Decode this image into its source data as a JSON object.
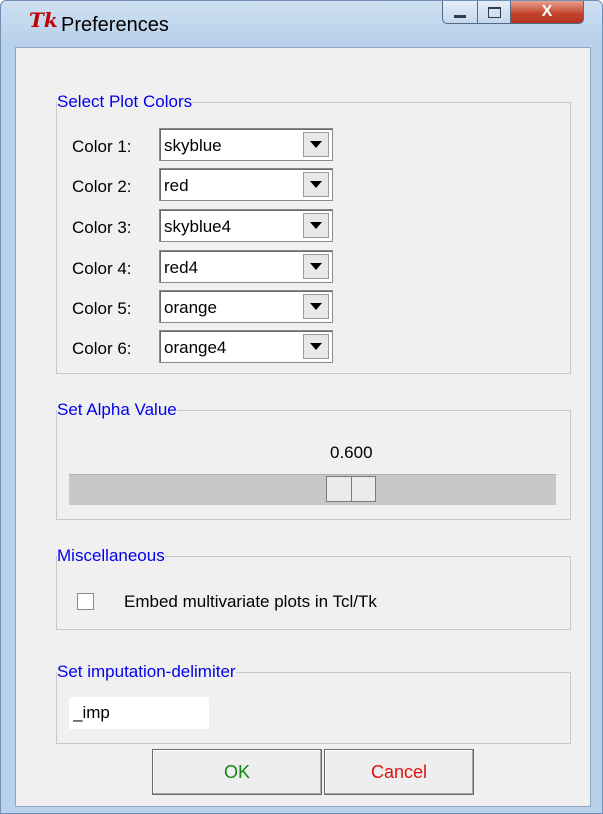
{
  "window": {
    "title": "Preferences",
    "icon": "tk-icon",
    "controls": {
      "close_label": "X"
    }
  },
  "plot_colors": {
    "legend": "Select Plot Colors",
    "rows": [
      {
        "label": "Color 1:",
        "value": "skyblue"
      },
      {
        "label": "Color 2:",
        "value": "red"
      },
      {
        "label": "Color 3:",
        "value": "skyblue4"
      },
      {
        "label": "Color 4:",
        "value": "red4"
      },
      {
        "label": "Color 5:",
        "value": "orange"
      },
      {
        "label": "Color 6:",
        "value": "orange4"
      }
    ]
  },
  "alpha": {
    "legend": "Set Alpha Value",
    "value_text": "0.600",
    "value": 0.6
  },
  "misc": {
    "legend": "Miscellaneous",
    "embed_label": "Embed multivariate plots in Tcl/Tk",
    "embed_checked": false
  },
  "imputation": {
    "legend": "Set imputation-delimiter",
    "value": "_imp"
  },
  "buttons": {
    "ok_label": "OK",
    "cancel_label": "Cancel"
  },
  "colors": {
    "legend_text": "#0000ee",
    "ok_text": "#118811",
    "cancel_text": "#dd1111",
    "close_button": "#c2412a"
  }
}
